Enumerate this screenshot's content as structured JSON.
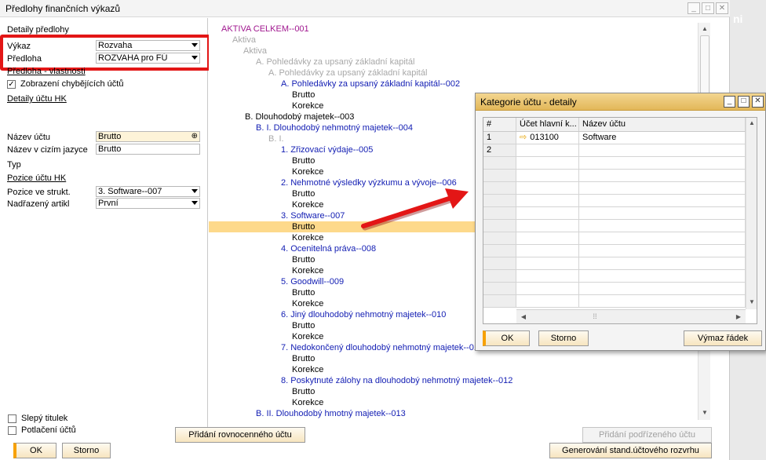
{
  "window": {
    "title": "Předlohy finančních výkazů",
    "bg_letter": "ni"
  },
  "left": {
    "section_details": "Detaily předlohy",
    "report_label": "Výkaz",
    "report_value": "Rozvaha",
    "template_label": "Předloha",
    "template_value": "ROZVAHA pro FÚ",
    "template_props_link": "Předloha - vlastnosti",
    "show_errors_label": "Zobrazení chybějících účtů",
    "account_details_link": "Detaily účtu HK",
    "account_name_label": "Název účtu",
    "account_name_value": "Brutto",
    "foreign_name_label": "Název v cizím jazyce",
    "foreign_name_value": "Brutto",
    "type_label": "Typ",
    "position_link": "Pozice účtu HK",
    "position_label": "Pozice ve strukt.",
    "position_value": "3. Software--007",
    "parent_label": "Nadřazený artikl",
    "parent_value": "První",
    "blind_title_label": "Slepý titulek",
    "suppress_label": "Potlačení účtů"
  },
  "tree": [
    {
      "text": "AKTIVA CELKEM--001",
      "color": "mag"
    },
    {
      "text": "Aktiva",
      "color": "grey"
    },
    {
      "text": "Aktiva",
      "color": "grey"
    },
    {
      "text": "A. Pohledávky za upsaný základní kapitál",
      "color": "grey"
    },
    {
      "text": "A. Pohledávky za upsaný základní kapitál",
      "color": "grey"
    },
    {
      "text": "A. Pohledávky za upsaný základní kapitál--002",
      "color": "blue"
    },
    {
      "text": "Brutto",
      "color": "blk"
    },
    {
      "text": "Korekce",
      "color": "blk"
    },
    {
      "text": "B. Dlouhodobý majetek--003",
      "color": "blk"
    },
    {
      "text": "B. I. Dlouhodobý nehmotný majetek--004",
      "color": "blue"
    },
    {
      "text": "B. I.",
      "color": "grey"
    },
    {
      "text": "1. Zřizovací výdaje--005",
      "color": "blue"
    },
    {
      "text": "Brutto",
      "color": "blk"
    },
    {
      "text": "Korekce",
      "color": "blk"
    },
    {
      "text": "2. Nehmotné výsledky výzkumu a vývoje--006",
      "color": "blue"
    },
    {
      "text": "Brutto",
      "color": "blk"
    },
    {
      "text": "Korekce",
      "color": "blk"
    },
    {
      "text": "3. Software--007",
      "color": "blue"
    },
    {
      "text": "Brutto",
      "color": "blk"
    },
    {
      "text": "Korekce",
      "color": "blk"
    },
    {
      "text": "4. Ocenitelná práva--008",
      "color": "blue"
    },
    {
      "text": "Brutto",
      "color": "blk"
    },
    {
      "text": "Korekce",
      "color": "blk"
    },
    {
      "text": "5. Goodwill--009",
      "color": "blue"
    },
    {
      "text": "Brutto",
      "color": "blk"
    },
    {
      "text": "Korekce",
      "color": "blk"
    },
    {
      "text": "6. Jiný dlouhodobý nehmotný majetek--010",
      "color": "blue"
    },
    {
      "text": "Brutto",
      "color": "blk"
    },
    {
      "text": "Korekce",
      "color": "blk"
    },
    {
      "text": "7. Nedokončený dlouhodobý nehmotný majetek--011",
      "color": "blue"
    },
    {
      "text": "Brutto",
      "color": "blk"
    },
    {
      "text": "Korekce",
      "color": "blk"
    },
    {
      "text": "8. Poskytnuté zálohy na dlouhodobý nehmotný majetek--012",
      "color": "blue"
    },
    {
      "text": "Brutto",
      "color": "blk"
    },
    {
      "text": "Korekce",
      "color": "blk"
    },
    {
      "text": "B. II. Dlouhodobý hmotný majetek--013",
      "color": "blue"
    }
  ],
  "buttons": {
    "ok": "OK",
    "cancel": "Storno",
    "add_equal": "Přidání rovnocenného účtu",
    "add_child": "Přidání podřízeného účtu",
    "generate": "Generování stand.účtového rozvrhu"
  },
  "dialog": {
    "title": "Kategorie účtu - detaily",
    "col_num": "#",
    "col_account": "Účet hlavní k...",
    "col_name": "Název účtu",
    "rows": [
      {
        "num": "1",
        "account": "013100",
        "name": "Software"
      },
      {
        "num": "2",
        "account": "",
        "name": ""
      }
    ],
    "ok": "OK",
    "cancel": "Storno",
    "delete_row": "Výmaz řádek"
  },
  "colors": {
    "highlight_row": "#fdd98b",
    "red_annotation": "#e31616",
    "tree_magenta": "#a0178f",
    "tree_blue": "#1520b4",
    "tree_grey": "#a8a8a8",
    "ok_accent": "#f7a100"
  }
}
